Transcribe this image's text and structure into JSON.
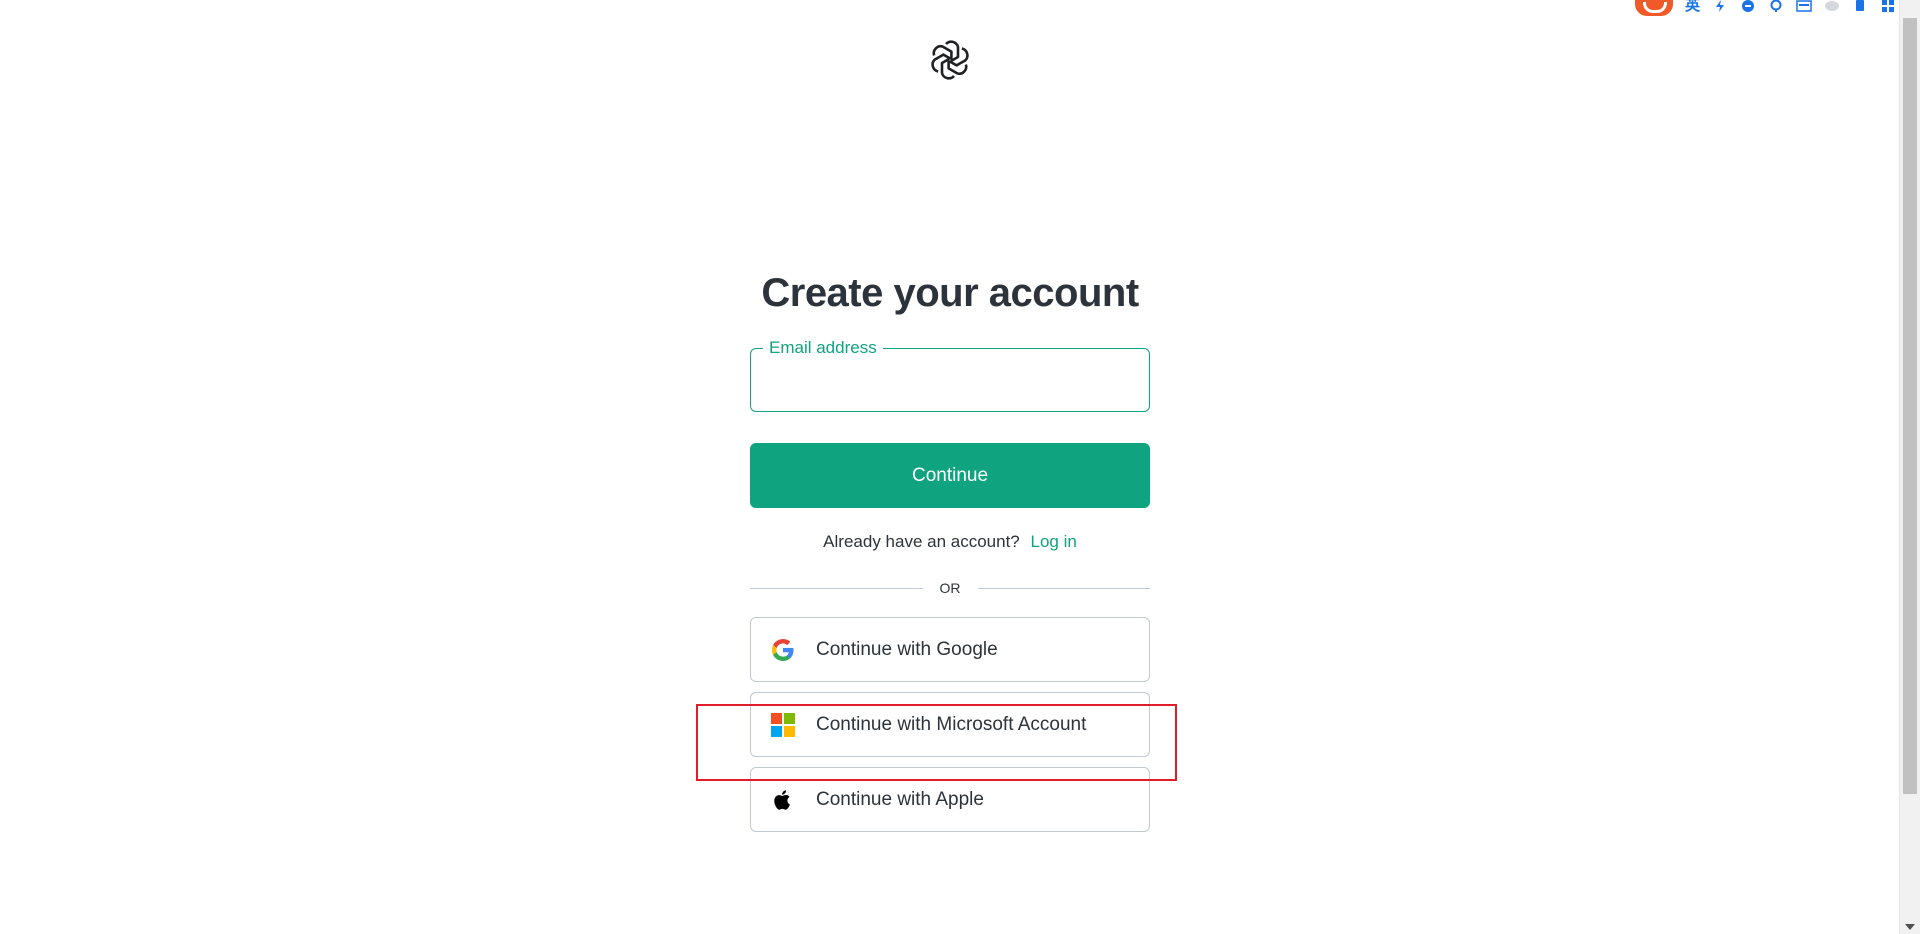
{
  "browser_extensions": {
    "language_indicator": "英",
    "icons": [
      "sogou-icon",
      "bolt-icon",
      "shield-icon",
      "pin-icon",
      "keyboard-icon",
      "cloud-icon",
      "battery-icon",
      "apps-icon"
    ]
  },
  "auth": {
    "title": "Create your account",
    "email": {
      "label": "Email address",
      "value": "",
      "placeholder": ""
    },
    "continue_label": "Continue",
    "login_prompt": "Already have an account?",
    "login_link": "Log in",
    "divider_text": "OR",
    "social": [
      {
        "label": "Continue with Google",
        "icon": "google-icon"
      },
      {
        "label": "Continue with Microsoft Account",
        "icon": "microsoft-icon"
      },
      {
        "label": "Continue with Apple",
        "icon": "apple-icon"
      }
    ]
  },
  "colors": {
    "brand": "#10a37f",
    "text": "#2d333a",
    "border": "#c2c8d0",
    "highlight": "#e01e2b",
    "microsoft": [
      "#f25022",
      "#7fba00",
      "#00a4ef",
      "#ffb900"
    ]
  }
}
